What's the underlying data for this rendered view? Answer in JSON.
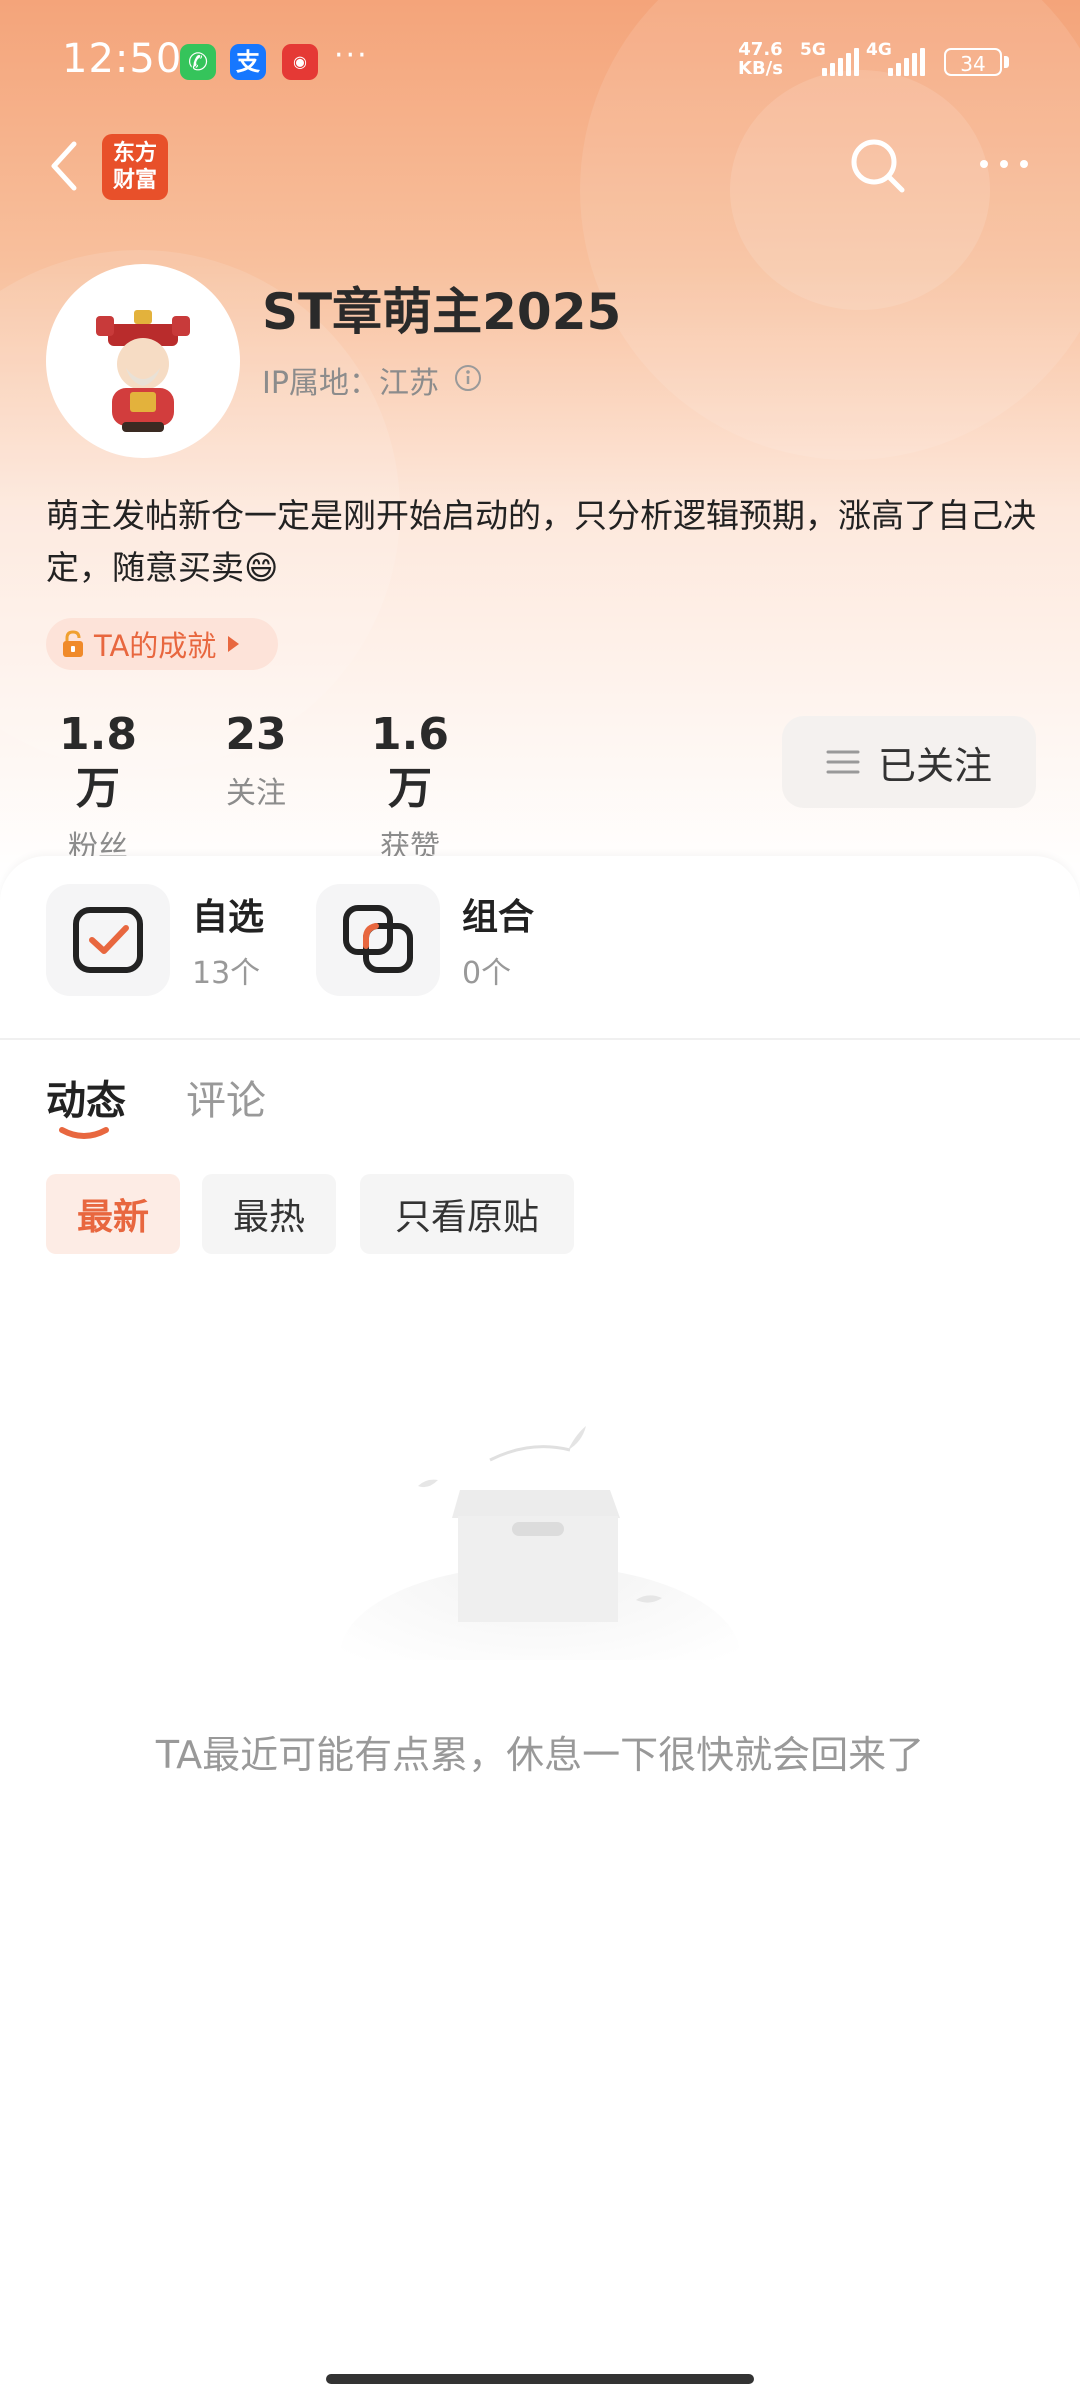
{
  "status_bar": {
    "time": "12:50",
    "network_speed_top": "47.6",
    "network_speed_bottom": "KB/s",
    "signal_1": "5G",
    "signal_2": "4G",
    "battery": "34"
  },
  "nav": {
    "logo_line1": "东方",
    "logo_line2": "财富"
  },
  "profile": {
    "username": "ST章萌主2025",
    "ip_location": "IP属地：江苏",
    "bio": "萌主发帖新仓一定是刚开始启动的，只分析逻辑预期，涨高了自己决定，随意买卖😄",
    "achievements_label": "TA的成就"
  },
  "stats": [
    {
      "value": "1.8万",
      "label": "粉丝"
    },
    {
      "value": "23",
      "label": "关注"
    },
    {
      "value": "1.6万",
      "label": "获赞"
    }
  ],
  "follow_button": {
    "label": "已关注"
  },
  "portfolio": {
    "watchlist": {
      "label": "自选",
      "count": "13个"
    },
    "combination": {
      "label": "组合",
      "count": "0个"
    }
  },
  "tabs": [
    {
      "label": "动态",
      "active": true
    },
    {
      "label": "评论",
      "active": false
    }
  ],
  "filters": [
    "最新",
    "最热",
    "只看原贴"
  ],
  "empty_state": {
    "message": "TA最近可能有点累，休息一下很快就会回来了"
  },
  "colors": {
    "accent": "#e8673f",
    "hero_top": "#f4a47a"
  }
}
